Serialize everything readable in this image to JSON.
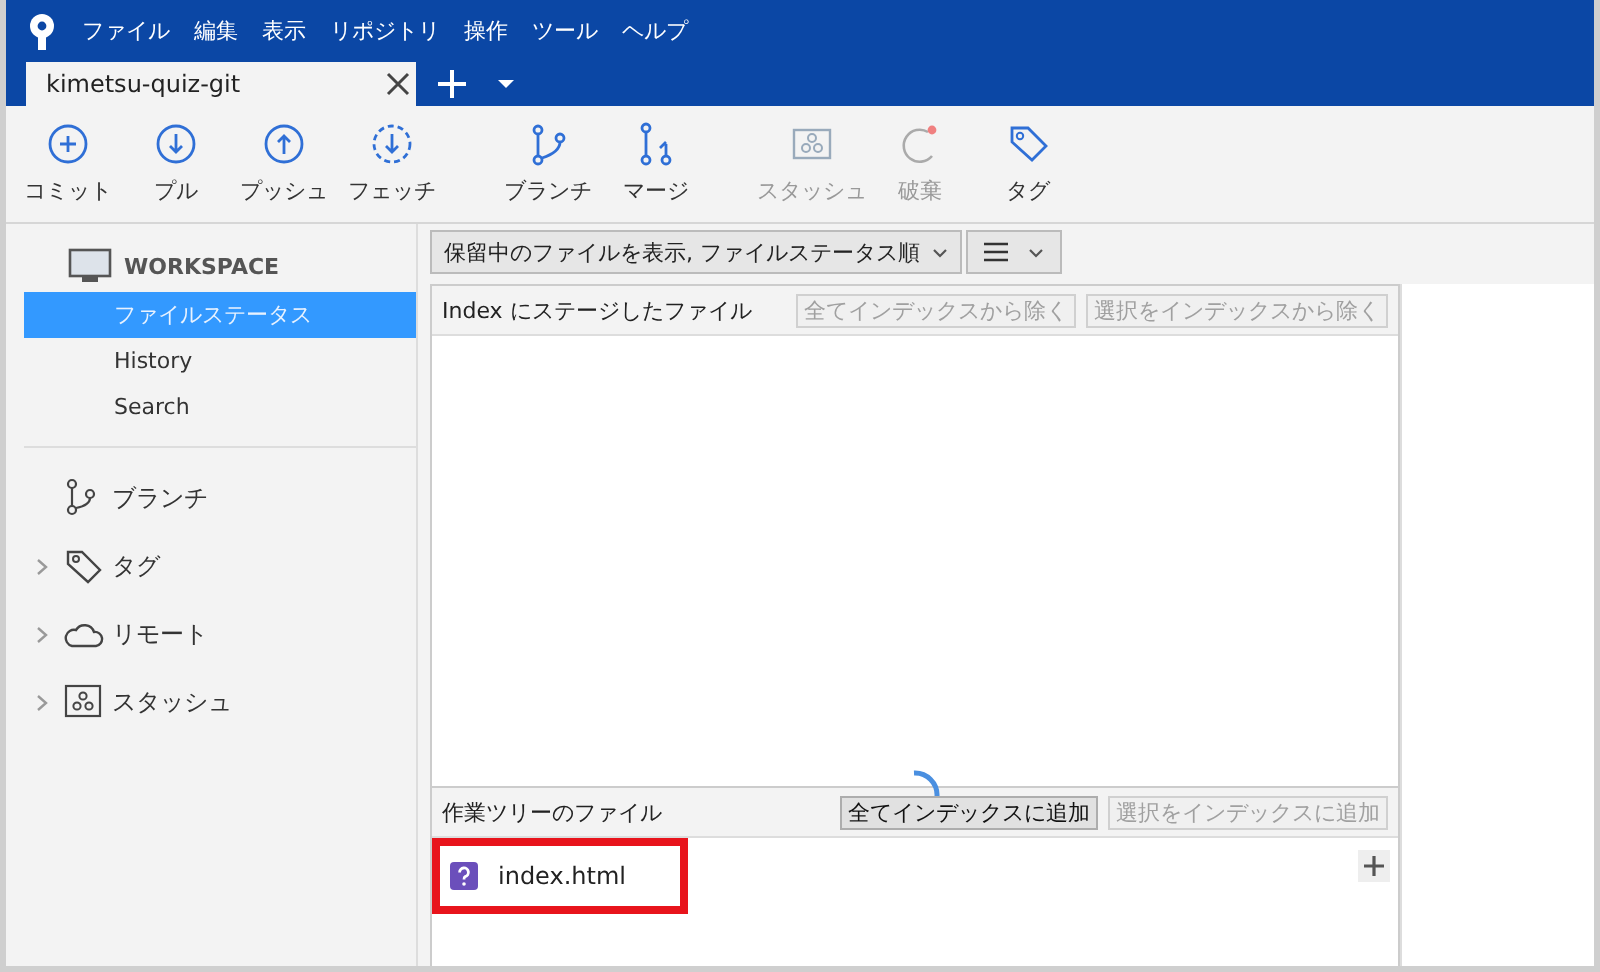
{
  "menu": [
    "ファイル",
    "編集",
    "表示",
    "リポジトリ",
    "操作",
    "ツール",
    "ヘルプ"
  ],
  "tabs": [
    {
      "label": "kimetsu-quiz-git",
      "selected": true
    }
  ],
  "toolbar": [
    {
      "kind": "commit",
      "label": "コミット",
      "disabled": false
    },
    {
      "kind": "pull",
      "label": "プル",
      "disabled": false
    },
    {
      "kind": "push",
      "label": "プッシュ",
      "disabled": false
    },
    {
      "kind": "fetch",
      "label": "フェッチ",
      "disabled": false
    },
    {
      "kind": "branch",
      "label": "ブランチ",
      "disabled": false
    },
    {
      "kind": "merge",
      "label": "マージ",
      "disabled": false
    },
    {
      "kind": "stash",
      "label": "スタッシュ",
      "disabled": true
    },
    {
      "kind": "discard",
      "label": "破棄",
      "disabled": true
    },
    {
      "kind": "tag",
      "label": "タグ",
      "disabled": false
    }
  ],
  "sidebar": {
    "workspace": {
      "label": "WORKSPACE",
      "items": [
        {
          "label": "ファイルステータス",
          "selected": true
        },
        {
          "label": "History",
          "selected": false
        },
        {
          "label": "Search",
          "selected": false
        }
      ]
    },
    "sections": [
      {
        "kind": "branch",
        "label": "ブランチ",
        "expandable": false
      },
      {
        "kind": "tag",
        "label": "タグ",
        "expandable": true
      },
      {
        "kind": "remote",
        "label": "リモート",
        "expandable": true
      },
      {
        "kind": "stash",
        "label": "スタッシュ",
        "expandable": true
      }
    ]
  },
  "filter": {
    "label": "保留中のファイルを表示, ファイルステータス順"
  },
  "staged": {
    "title": "Index にステージしたファイル",
    "buttons": [
      {
        "label": "全てインデックスから除く",
        "disabled": true
      },
      {
        "label": "選択をインデックスから除く",
        "disabled": true
      }
    ]
  },
  "unstaged": {
    "title": "作業ツリーのファイル",
    "loading": true,
    "buttons": [
      {
        "label": "全てインデックスに追加",
        "disabled": false
      },
      {
        "label": "選択をインデックスに追加",
        "disabled": true
      }
    ],
    "files": [
      {
        "name": "index.html",
        "kind": "untracked",
        "highlighted": true
      }
    ]
  }
}
